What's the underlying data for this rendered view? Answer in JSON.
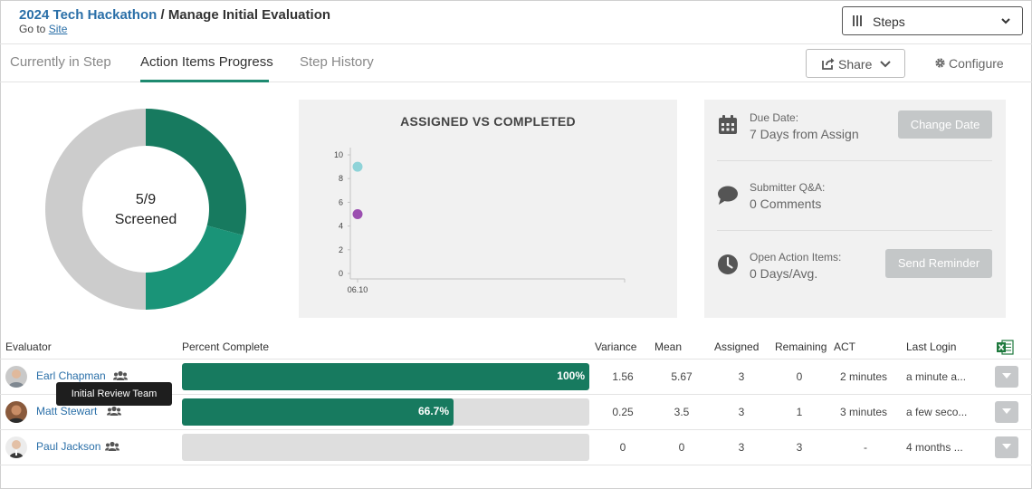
{
  "header": {
    "event_link": "2024 Tech Hackathon",
    "separator": " / ",
    "title": "Manage Initial Evaluation",
    "goto_prefix": "Go to ",
    "goto_link": "Site",
    "steps_label": "Steps"
  },
  "tabs": [
    {
      "label": "Currently in Step",
      "active": false
    },
    {
      "label": "Action Items Progress",
      "active": true
    },
    {
      "label": "Step History",
      "active": false
    }
  ],
  "toolbar": {
    "share_label": "Share",
    "configure_label": "Configure"
  },
  "donut": {
    "ratio_text": "5/9",
    "status_text": "Screened",
    "completed": 5,
    "total": 9,
    "segments": [
      {
        "value": 3.5,
        "color": "#177a5f"
      },
      {
        "value": 2.5,
        "color": "#1a9478"
      },
      {
        "value": 6,
        "color": "#cccccc"
      }
    ]
  },
  "chart_data": {
    "type": "scatter",
    "title": "ASSIGNED VS COMPLETED",
    "x_ticks": [
      "06.10"
    ],
    "y_ticks": [
      0,
      2,
      4,
      6,
      8,
      10
    ],
    "ylim": [
      0,
      10
    ],
    "points": [
      {
        "x": "06.10",
        "y": 9,
        "color": "#8fd3d8"
      },
      {
        "x": "06.10",
        "y": 5,
        "color": "#9b4fb0"
      }
    ]
  },
  "info": {
    "due_label": "Due Date:",
    "due_value": "7 Days from Assign",
    "change_date_label": "Change Date",
    "qa_label": "Submitter Q&A:",
    "qa_value": "0 Comments",
    "open_label": "Open Action Items:",
    "open_value": "0 Days/Avg.",
    "reminder_label": "Send Reminder"
  },
  "table": {
    "columns": {
      "evaluator": "Evaluator",
      "percent": "Percent Complete",
      "variance": "Variance",
      "mean": "Mean",
      "assigned": "Assigned",
      "remaining": "Remaining",
      "act": "ACT",
      "last_login": "Last Login"
    },
    "rows": [
      {
        "name": "Earl Chapman",
        "percent": 1.0,
        "percent_label": "100%",
        "variance": "1.56",
        "mean": "5.67",
        "assigned": "3",
        "remaining": "0",
        "act": "2 minutes",
        "last_login": "a minute a..."
      },
      {
        "name": "Matt Stewart",
        "percent": 0.667,
        "percent_label": "66.7%",
        "variance": "0.25",
        "mean": "3.5",
        "assigned": "3",
        "remaining": "1",
        "act": "3 minutes",
        "last_login": "a few seco..."
      },
      {
        "name": "Paul Jackson",
        "percent": 0,
        "percent_label": "",
        "variance": "0",
        "mean": "0",
        "assigned": "3",
        "remaining": "3",
        "act": "-",
        "last_login": "4 months ..."
      }
    ],
    "tooltip": "Initial Review Team"
  }
}
